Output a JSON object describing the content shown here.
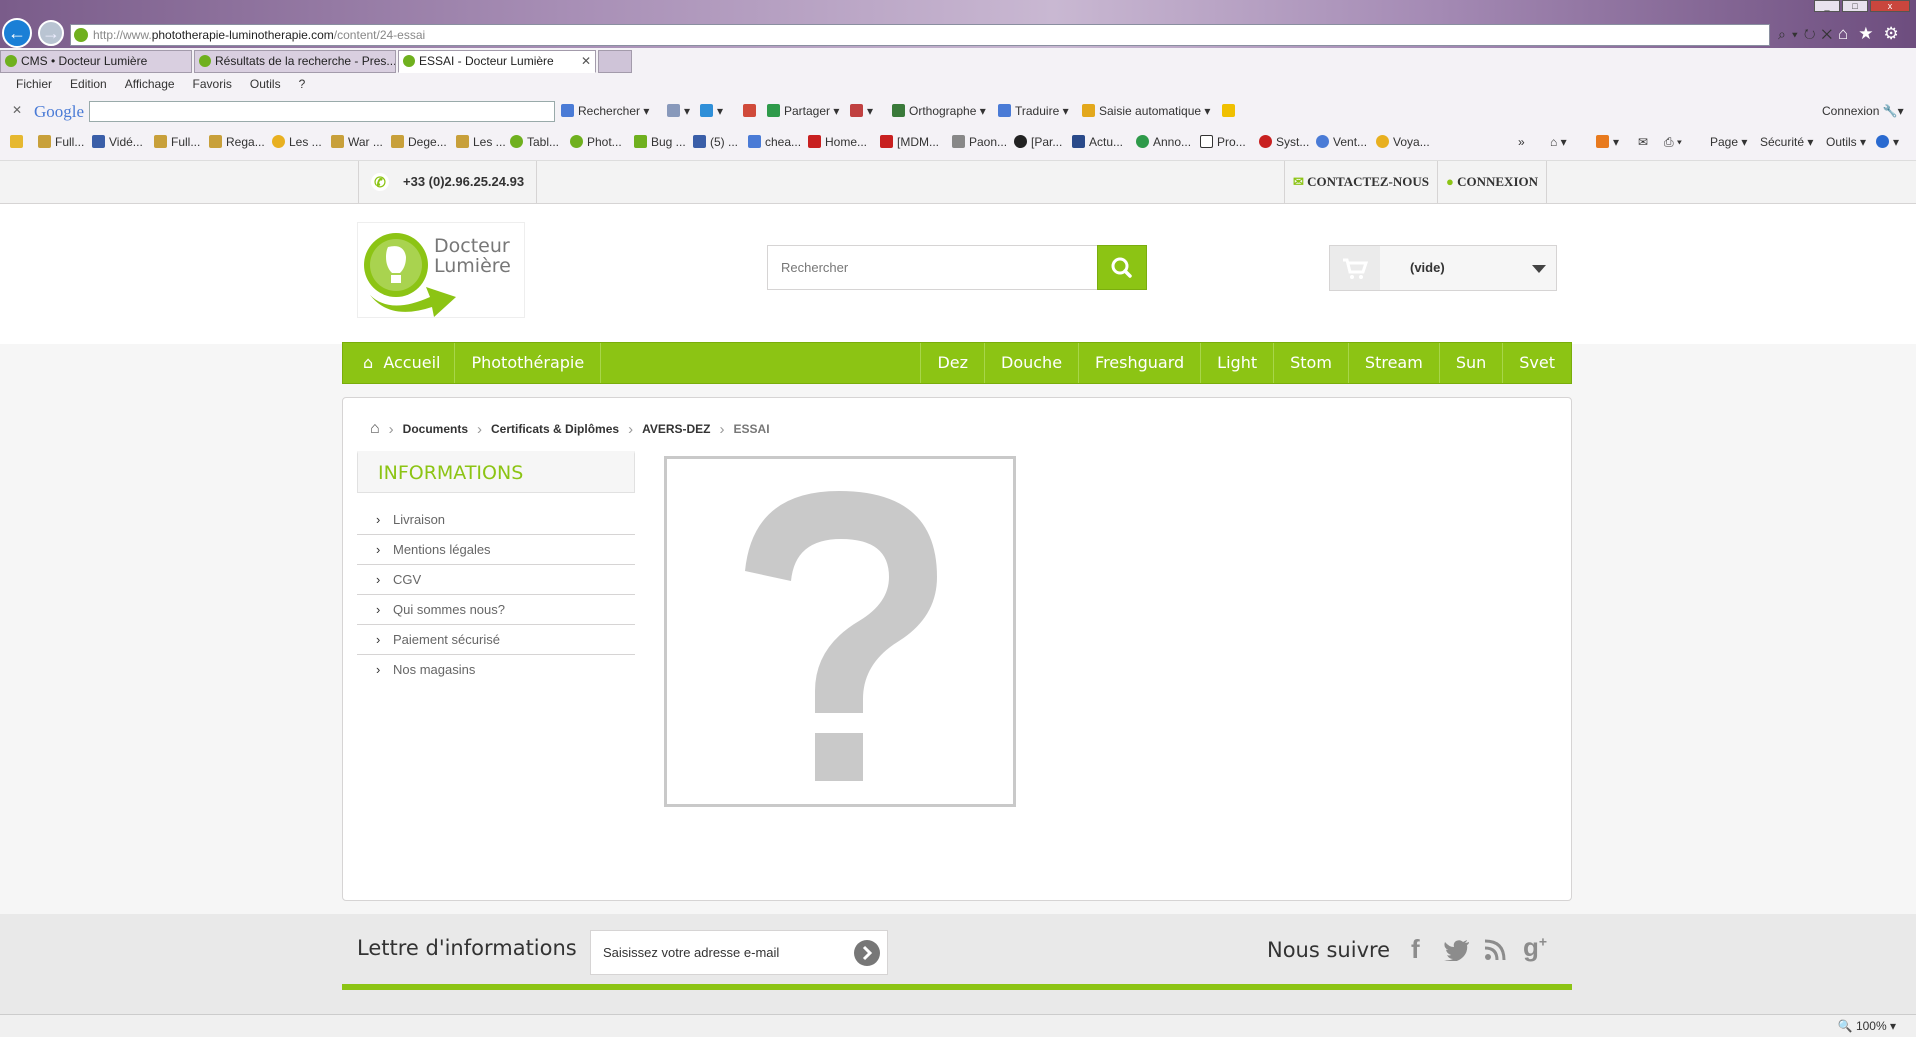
{
  "browser": {
    "url_prefix": "http://www.",
    "url_domain": "phototherapie-luminotherapie.com",
    "url_path": "/content/24-essai",
    "tabs": [
      {
        "label": "CMS • Docteur Lumière",
        "active": false
      },
      {
        "label": "Résultats de la recherche - Pres...",
        "active": false
      },
      {
        "label": "ESSAI - Docteur Lumière",
        "active": true
      }
    ],
    "menu": [
      "Fichier",
      "Edition",
      "Affichage",
      "Favoris",
      "Outils",
      "?"
    ],
    "google_bar": {
      "logo": "Google",
      "search_label": "Rechercher",
      "share_label": "Partager",
      "spell_label": "Orthographe",
      "translate_label": "Traduire",
      "autofill_label": "Saisie automatique",
      "signin_label": "Connexion"
    },
    "favorites": [
      "Full...",
      "Vidé...",
      "Full...",
      "Rega...",
      "Les ...",
      "War ...",
      "Dege...",
      "Les ...",
      "Tabl...",
      "Phot...",
      "Bug ...",
      "(5) ...",
      "chea...",
      "Home...",
      "[MDM...",
      "Paon...",
      "[Par...",
      "Actu...",
      "Anno...",
      "Pro...",
      "Syst...",
      "Vent...",
      "Voya..."
    ],
    "command_bar": [
      "Page",
      "Sécurité",
      "Outils"
    ],
    "zoom": "100%"
  },
  "site": {
    "phone": "+33 (0)2.96.25.24.93",
    "contact_label": "CONTACTEZ-NOUS",
    "login_label": "CONNEXION",
    "logo_line1": "Docteur",
    "logo_line2": "Lumière",
    "search_placeholder": "Rechercher",
    "cart_label": "(vide)",
    "nav_left": [
      "Accueil",
      "Photothérapie"
    ],
    "nav_right": [
      "Dez",
      "Douche",
      "Freshguard",
      "Light",
      "Stom",
      "Stream",
      "Sun",
      "Svet"
    ],
    "breadcrumb": [
      "Documents",
      "Certificats & Diplômes",
      "AVERS-DEZ",
      "ESSAI"
    ],
    "info_title": "INFORMATIONS",
    "info_links": [
      "Livraison",
      "Mentions légales",
      "CGV",
      "Qui sommes nous?",
      "Paiement sécurisé",
      "Nos magasins"
    ],
    "newsletter_title": "Lettre d'informations",
    "newsletter_placeholder": "Saisissez votre adresse e-mail",
    "follow_title": "Nous suivre",
    "accent_color": "#8cc414"
  }
}
